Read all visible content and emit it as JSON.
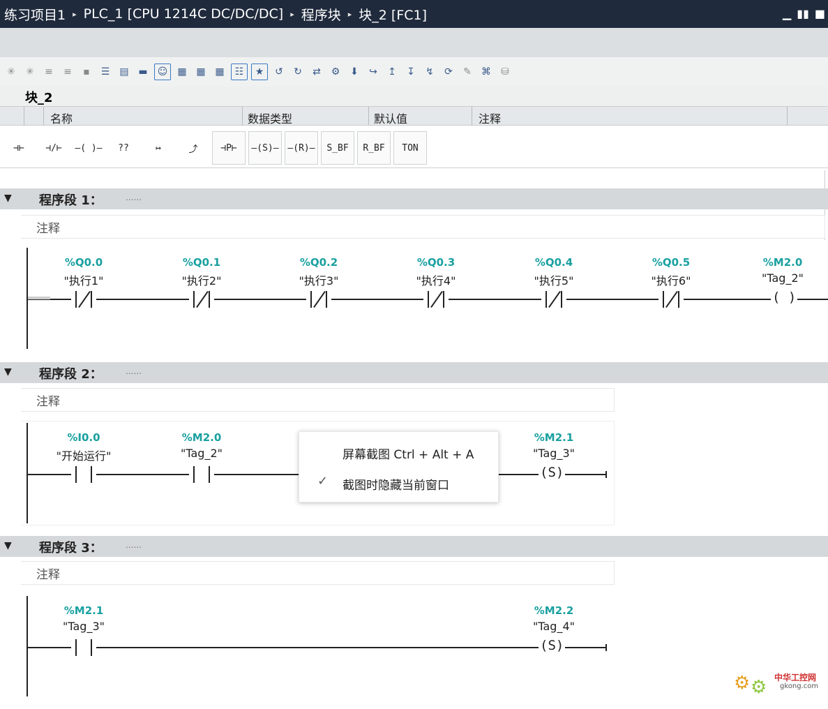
{
  "title": {
    "breadcrumb": [
      "练习项目1",
      "PLC_1 [CPU 1214C DC/DC/DC]",
      "程序块",
      "块_2 [FC1]"
    ],
    "separator": "▸",
    "win_min": "▁",
    "win_tile": "▮▮",
    "win_max": "■"
  },
  "block": {
    "name": "块_2"
  },
  "interface": {
    "col_name": "名称",
    "col_type": "数据类型",
    "col_default": "默认值",
    "col_comment": "注释"
  },
  "ladder_toolbar": {
    "no_contact": "⊣⊢",
    "nc_contact": "⊣/⊢",
    "coil": "–( )–",
    "empty_box": "??",
    "open_branch": "↦",
    "close_branch": "⤴",
    "p_contact": "⊣P⊢",
    "set_coil": "–(S)–",
    "reset_coil": "–(R)–",
    "set_bf": "S_BF",
    "reset_bf": "R_BF",
    "ton": "TON"
  },
  "segments": [
    {
      "title": "程序段 1：",
      "dots": "......",
      "comment": "注释",
      "elements": [
        {
          "addr": "%Q0.0",
          "tag": "\"执行1\""
        },
        {
          "addr": "%Q0.1",
          "tag": "\"执行2\""
        },
        {
          "addr": "%Q0.2",
          "tag": "\"执行3\""
        },
        {
          "addr": "%Q0.3",
          "tag": "\"执行4\""
        },
        {
          "addr": "%Q0.4",
          "tag": "\"执行5\""
        },
        {
          "addr": "%Q0.5",
          "tag": "\"执行6\""
        },
        {
          "addr": "%M2.0",
          "tag": "\"Tag_2\"",
          "coil": "(  )"
        }
      ]
    },
    {
      "title": "程序段 2：",
      "dots": "......",
      "comment": "注释",
      "elements": [
        {
          "addr": "%I0.0",
          "tag": "\"开始运行\""
        },
        {
          "addr": "%M2.0",
          "tag": "\"Tag_2\""
        },
        {
          "addr": "%M2.1",
          "tag": "\"Tag_3\"",
          "coil": "(S)"
        }
      ]
    },
    {
      "title": "程序段 3：",
      "dots": "......",
      "comment": "注释",
      "elements": [
        {
          "addr": "%M2.1",
          "tag": "\"Tag_3\""
        },
        {
          "addr": "%M2.2",
          "tag": "\"Tag_4\"",
          "coil": "(S)"
        }
      ]
    }
  ],
  "context_menu": {
    "item1": "屏幕截图 Ctrl + Alt + A",
    "item2": "截图时隐藏当前窗口",
    "item2_checked": true,
    "check": "✓"
  },
  "watermark": {
    "text": "中华工控网",
    "sub": "gkong.com"
  }
}
